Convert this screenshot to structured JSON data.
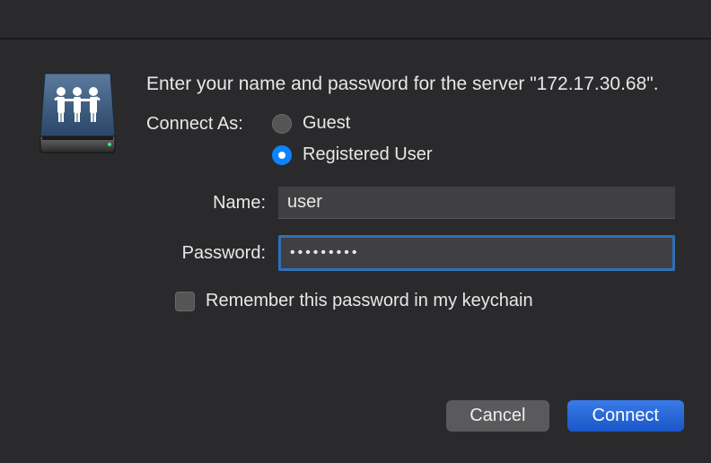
{
  "prompt": "Enter your name and password for the server \"172.17.30.68\".",
  "connect_as_label": "Connect As:",
  "radio_guest": "Guest",
  "radio_registered": "Registered User",
  "name_label": "Name:",
  "name_value": "user",
  "password_label": "Password:",
  "password_value": "•••••••••",
  "remember_label": "Remember this password in my keychain",
  "cancel_label": "Cancel",
  "connect_label": "Connect",
  "icon_name": "network-share-icon"
}
